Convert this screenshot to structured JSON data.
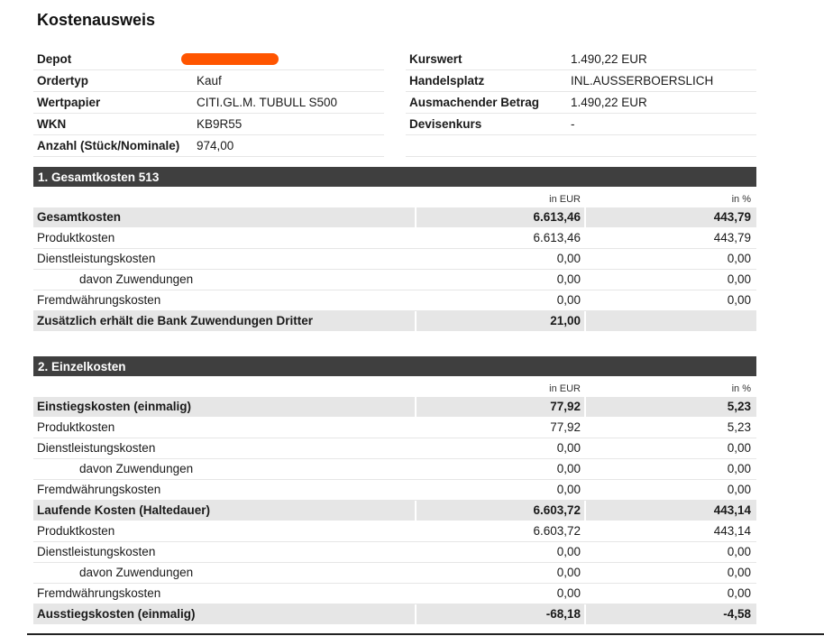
{
  "title": "Kostenausweis",
  "colors": {
    "header_bg": "#3f3f3f",
    "highlight_bg": "#e6e6e6",
    "redaction": "#ff5500"
  },
  "info_left": [
    {
      "label": "Depot",
      "value": ""
    },
    {
      "label": "Ordertyp",
      "value": "Kauf"
    },
    {
      "label": "Wertpapier",
      "value": "CITI.GL.M. TUBULL S500"
    },
    {
      "label": "WKN",
      "value": "KB9R55"
    },
    {
      "label": "Anzahl (Stück/Nominale)",
      "value": "974,00"
    }
  ],
  "info_right": [
    {
      "label": "Kurswert",
      "value": "1.490,22 EUR"
    },
    {
      "label": "Handelsplatz",
      "value": "INL.AUSSERBOERSLICH"
    },
    {
      "label": "Ausmachender Betrag",
      "value": "1.490,22 EUR"
    },
    {
      "label": "Devisenkurs",
      "value": "-"
    },
    {
      "label": "",
      "value": ""
    }
  ],
  "sections": [
    {
      "title": "1. Gesamtkosten 513",
      "col1": "in EUR",
      "col2": "in %",
      "rows": [
        {
          "label": "Gesamtkosten",
          "eur": "6.613,46",
          "pct": "443,79"
        },
        {
          "label": "Produktkosten",
          "eur": "6.613,46",
          "pct": "443,79"
        },
        {
          "label": "Dienstleistungskosten",
          "eur": "0,00",
          "pct": "0,00"
        },
        {
          "label": "davon Zuwendungen",
          "eur": "0,00",
          "pct": "0,00"
        },
        {
          "label": "Fremdwährungskosten",
          "eur": "0,00",
          "pct": "0,00"
        },
        {
          "label": "Zusätzlich erhält die Bank Zuwendungen Dritter",
          "eur": "21,00",
          "pct": ""
        }
      ]
    },
    {
      "title": "2. Einzelkosten",
      "col1": "in EUR",
      "col2": "in %",
      "rows": [
        {
          "label": "Einstiegskosten (einmalig)",
          "eur": "77,92",
          "pct": "5,23"
        },
        {
          "label": "Produktkosten",
          "eur": "77,92",
          "pct": "5,23"
        },
        {
          "label": "Dienstleistungskosten",
          "eur": "0,00",
          "pct": "0,00"
        },
        {
          "label": "davon Zuwendungen",
          "eur": "0,00",
          "pct": "0,00"
        },
        {
          "label": "Fremdwährungskosten",
          "eur": "0,00",
          "pct": "0,00"
        },
        {
          "label": "Laufende Kosten (Haltedauer)",
          "eur": "6.603,72",
          "pct": "443,14"
        },
        {
          "label": "Produktkosten",
          "eur": "6.603,72",
          "pct": "443,14"
        },
        {
          "label": "Dienstleistungskosten",
          "eur": "0,00",
          "pct": "0,00"
        },
        {
          "label": "davon Zuwendungen",
          "eur": "0,00",
          "pct": "0,00"
        },
        {
          "label": "Fremdwährungskosten",
          "eur": "0,00",
          "pct": "0,00"
        },
        {
          "label": "Ausstiegskosten (einmalig)",
          "eur": "-68,18",
          "pct": "-4,58"
        }
      ]
    }
  ]
}
